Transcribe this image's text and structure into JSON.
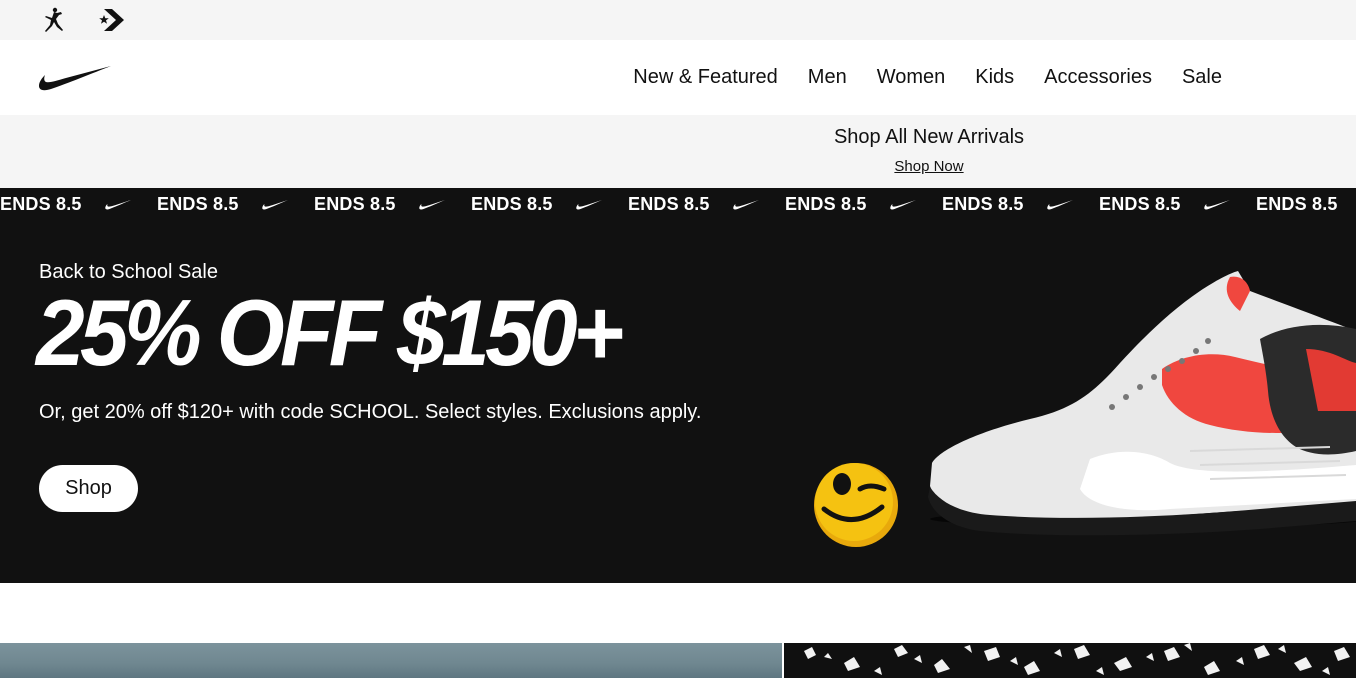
{
  "utility": {
    "icons": [
      "jordan-icon",
      "converse-icon"
    ]
  },
  "header": {
    "logo": "nike-swoosh-icon",
    "nav": [
      "New & Featured",
      "Men",
      "Women",
      "Kids",
      "Accessories",
      "Sale"
    ]
  },
  "promo": {
    "title": "Shop All New Arrivals",
    "link": "Shop Now"
  },
  "ticker": {
    "text": "ENDS 8.5",
    "repeat": 9
  },
  "hero": {
    "kicker": "Back to School Sale",
    "headline": "25% OFF $150+",
    "body": "Or, get 20% off $120+ with code SCHOOL. Select styles. Exclusions apply.",
    "button": "Shop",
    "images": [
      "winking-smiley-icon",
      "sneaker-image"
    ]
  },
  "colors": {
    "bg_dark": "#111111",
    "bg_light": "#f5f5f5",
    "accent_red": "#f0473f",
    "smiley_yellow": "#f5c211"
  }
}
